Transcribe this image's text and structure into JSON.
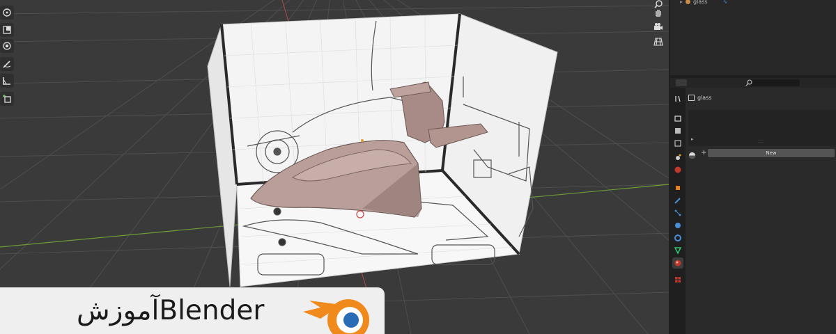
{
  "app": {
    "name": "Blender"
  },
  "banner": {
    "title": "آموزشBlender"
  },
  "colors": {
    "viewport_bg": "#3a3a3a",
    "grid_line": "#505050",
    "axis_x": "#b04a4a",
    "axis_y": "#6f9a3a",
    "panel_bg": "#1e1e1e",
    "accent_orange": "#f18a1c",
    "blender_blue": "#2a6cb6",
    "model_surface": "#b89c98"
  },
  "toolbar": {
    "tools": [
      {
        "icon": "rotate-icon"
      },
      {
        "icon": "scale-icon"
      },
      {
        "icon": "transform-icon"
      },
      {
        "icon": "annotate-icon"
      },
      {
        "icon": "measure-icon"
      },
      {
        "icon": "add-cube-icon"
      }
    ]
  },
  "navigation": {
    "gizmo": [
      {
        "icon": "zoom-icon"
      },
      {
        "icon": "pan-hand-icon"
      },
      {
        "icon": "camera-icon"
      },
      {
        "icon": "grid-view-icon"
      }
    ]
  },
  "outliner": {
    "row_label": "glass"
  },
  "properties": {
    "search_placeholder": "",
    "material_name": "glass",
    "new_button": "New",
    "plus_label": "+",
    "list_grip": "::::",
    "tabs": [
      {
        "icon": "tool-icon"
      },
      {
        "icon": "render-icon"
      },
      {
        "icon": "output-icon"
      },
      {
        "icon": "view-layer-icon"
      },
      {
        "icon": "scene-icon"
      },
      {
        "icon": "world-icon"
      },
      {
        "icon": "object-icon"
      },
      {
        "icon": "modifier-icon"
      },
      {
        "icon": "particles-icon"
      },
      {
        "icon": "physics-icon"
      },
      {
        "icon": "constraints-icon"
      },
      {
        "icon": "data-icon"
      },
      {
        "icon": "material-icon"
      },
      {
        "icon": "texture-icon"
      }
    ]
  }
}
